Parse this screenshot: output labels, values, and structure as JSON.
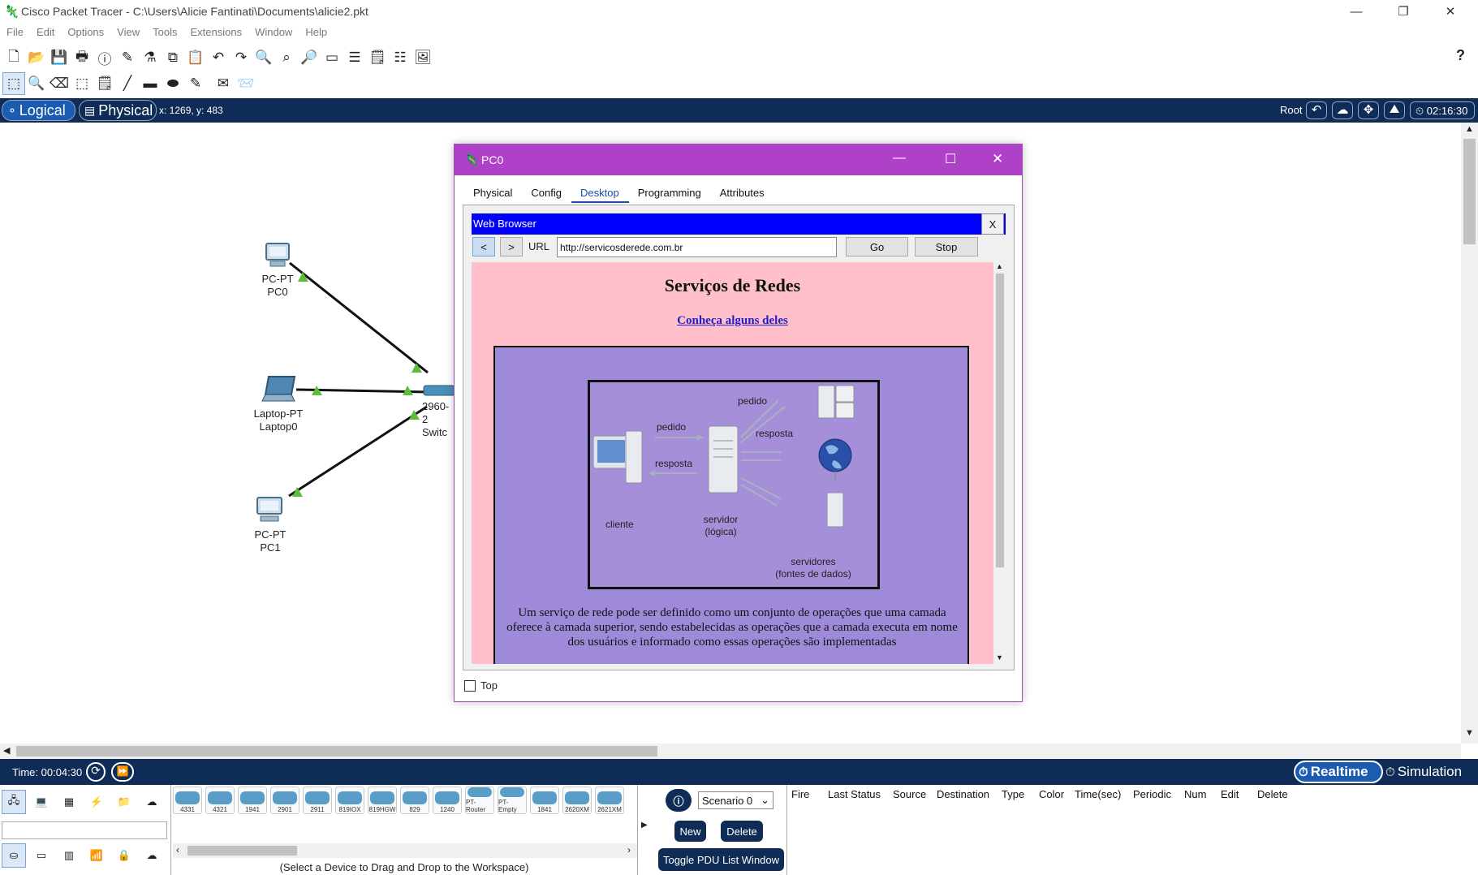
{
  "window": {
    "title": "Cisco Packet Tracer - C:\\Users\\Alicie Fantinati\\Documents\\alicie2.pkt",
    "minimize": "—",
    "restore": "❐",
    "close": "✕"
  },
  "menu": [
    "File",
    "Edit",
    "Options",
    "View",
    "Tools",
    "Extensions",
    "Window",
    "Help"
  ],
  "help_icon": "?",
  "modebar": {
    "logical_label": "Logical",
    "physical_label": "Physical",
    "coords": "x: 1269, y: 483",
    "root_label": "Root",
    "clock": "02:16:30"
  },
  "devices": [
    {
      "type": "PC-PT",
      "name": "PC0"
    },
    {
      "type": "Laptop-PT",
      "name": "Laptop0"
    },
    {
      "type": "PC-PT",
      "name": "PC1"
    },
    {
      "type": "2960-2",
      "name": "Switc"
    }
  ],
  "pc_window": {
    "title": "PC0",
    "tabs": [
      "Physical",
      "Config",
      "Desktop",
      "Programming",
      "Attributes"
    ],
    "active_tab": "Desktop",
    "top_label": "Top",
    "browser": {
      "title": "Web Browser",
      "close_label": "X",
      "back_label": "<",
      "forward_label": ">",
      "url_label": "URL",
      "url_value": "http://servicosderede.com.br",
      "go_label": "Go",
      "stop_label": "Stop",
      "page": {
        "heading": "Serviços de Redes",
        "link": "Conheça alguns deles",
        "diagram": {
          "client": "cliente",
          "server_line1": "servidor",
          "server_line2": "(lógica)",
          "servers_line1": "servidores",
          "servers_line2": "(fontes de dados)",
          "pedido1": "pedido",
          "resposta1": "resposta",
          "pedido2": "pedido",
          "resposta2": "resposta"
        },
        "paragraph": "Um serviço de rede pode ser definido como um conjunto de operações que uma camada oferece à camada superior, sendo estabelecidas as operações que a camada executa em nome dos usuários e informado como essas operações são implementadas"
      }
    }
  },
  "status": {
    "time": "Time: 00:04:30",
    "realtime": "Realtime",
    "simulation": "Simulation"
  },
  "device_models": [
    "4331",
    "4321",
    "1941",
    "2901",
    "2911",
    "819IOX",
    "819HGW",
    "829",
    "1240",
    "PT-Router",
    "PT-Empty",
    "1841",
    "2620XM",
    "2621XM"
  ],
  "select_hint": "(Select a Device to Drag and Drop to the Workspace)",
  "scenario": {
    "selected": "Scenario 0",
    "new_label": "New",
    "delete_label": "Delete",
    "toggle_label": "Toggle PDU List Window"
  },
  "pdu_columns": [
    "Fire",
    "Last Status",
    "Source",
    "Destination",
    "Type",
    "Color",
    "Time(sec)",
    "Periodic",
    "Num",
    "Edit",
    "Delete"
  ],
  "colors": {
    "dark_blue": "#0e2c55",
    "window_purple": "#ae41c8",
    "browser_blue": "#0000ff",
    "page_pink": "#ffc0cb",
    "box_purple": "#9e8ad8",
    "link_green": "#5bbd3a"
  }
}
